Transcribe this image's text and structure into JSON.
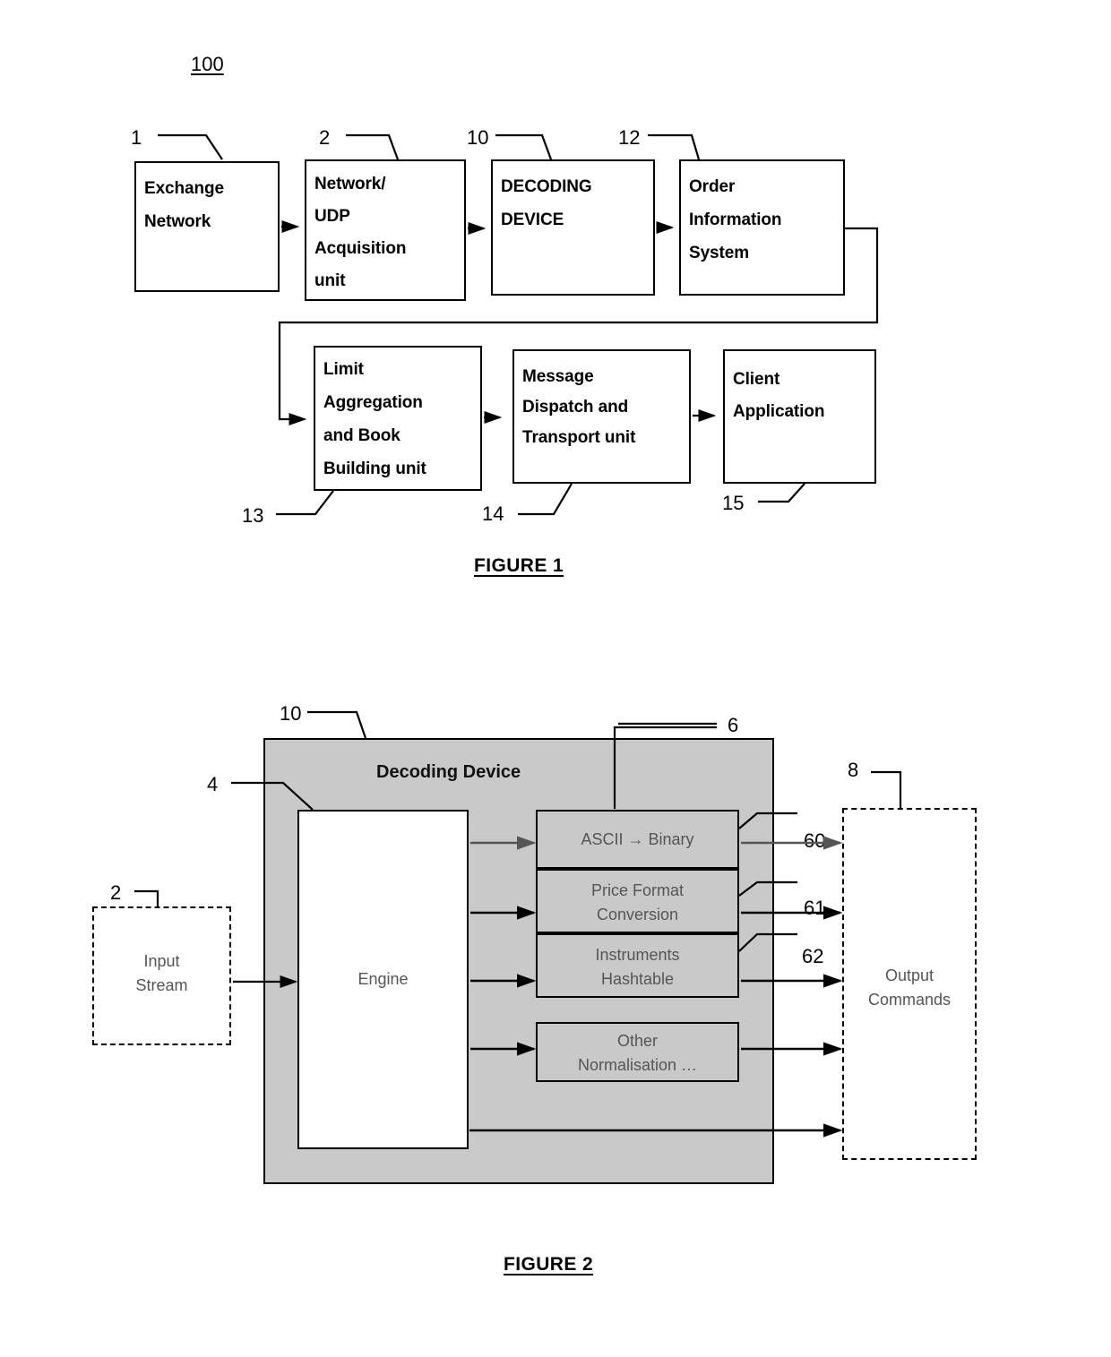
{
  "document": {
    "type": "patent-figure-sheet",
    "figure_number_top": "100"
  },
  "figure1": {
    "caption": "FIGURE 1",
    "boxes": [
      {
        "ref": "1",
        "label": "Exchange\nNetwork"
      },
      {
        "ref": "2",
        "label": "Network/\nUDP\nAcquisition\nunit"
      },
      {
        "ref": "10",
        "label": "DECODING\nDEVICE"
      },
      {
        "ref": "12",
        "label": "Order\nInformation\nSystem"
      },
      {
        "ref": "13",
        "label": "Limit\nAggregation\nand Book\nBuilding unit"
      },
      {
        "ref": "14",
        "label": "Message\nDispatch and\nTransport unit"
      },
      {
        "ref": "15",
        "label": "Client\nApplication"
      }
    ]
  },
  "figure2": {
    "caption": "FIGURE 2",
    "panel": {
      "ref": "10",
      "label": "Decoding Device"
    },
    "engine": {
      "ref": "4",
      "label": "Engine"
    },
    "input": {
      "ref": "2",
      "label": "Input\nStream"
    },
    "output": {
      "ref": "8",
      "label": "Output\nCommands"
    },
    "module_group_ref": "6",
    "modules": [
      {
        "ref": "60",
        "label": "ASCII → Binary"
      },
      {
        "ref": "61",
        "label": "Price Format\nConversion"
      },
      {
        "ref": "62",
        "label": "Instruments\nHashtable"
      },
      {
        "ref": "",
        "label": "Other\nNormalisation …"
      }
    ]
  },
  "colors": {
    "panel_fill": "#c9c9c9",
    "stroke": "#000000",
    "background": "#ffffff"
  }
}
